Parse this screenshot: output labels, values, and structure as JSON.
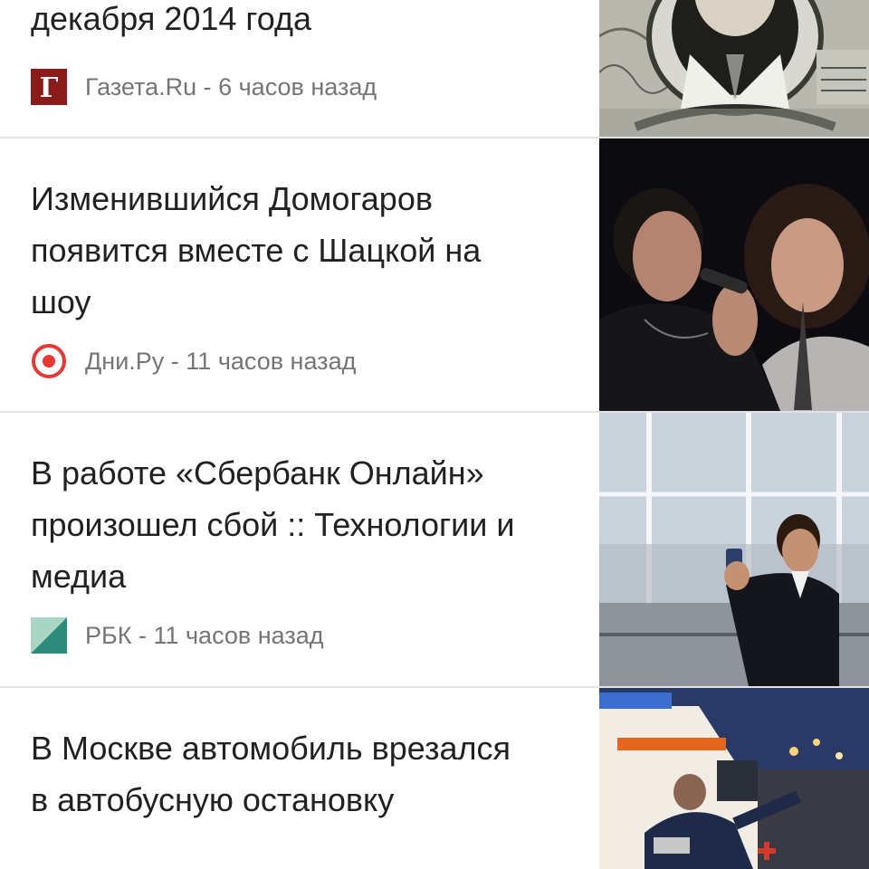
{
  "articles": [
    {
      "headline_lines": [
        "декабря 2014 года"
      ],
      "source": "Газета.Ru",
      "time": "6 часов назад",
      "meta": "Газета.Ru - 6 часов назад",
      "icon": "gazeta-logo-icon",
      "icon_letter": "Г",
      "icon_color": "#8b1a1a",
      "thumb": "dollar-banknote-portrait"
    },
    {
      "headline_lines": [
        "Изменившийся Домогаров",
        "появится вместе с Шацкой на",
        "шоу"
      ],
      "source": "Дни.Ру",
      "time": "11 часов назад",
      "meta": "Дни.Ру - 11 часов назад",
      "icon": "dni-ru-target-icon",
      "icon_color": "#e53935",
      "thumb": "singers-on-stage"
    },
    {
      "headline_lines": [
        "В работе «Сбербанк Онлайн»",
        "произошел сбой :: Технологии и",
        "медиа"
      ],
      "source": "РБК",
      "time": "11 часов назад",
      "meta": "РБК - 11 часов назад",
      "icon": "rbc-logo-icon",
      "icon_color": "#2e8b7a",
      "thumb": "man-with-phone-office"
    },
    {
      "headline_lines": [
        "В Москве автомобиль врезался",
        "в автобусную остановку"
      ],
      "thumb": "ambulance-night"
    }
  ]
}
